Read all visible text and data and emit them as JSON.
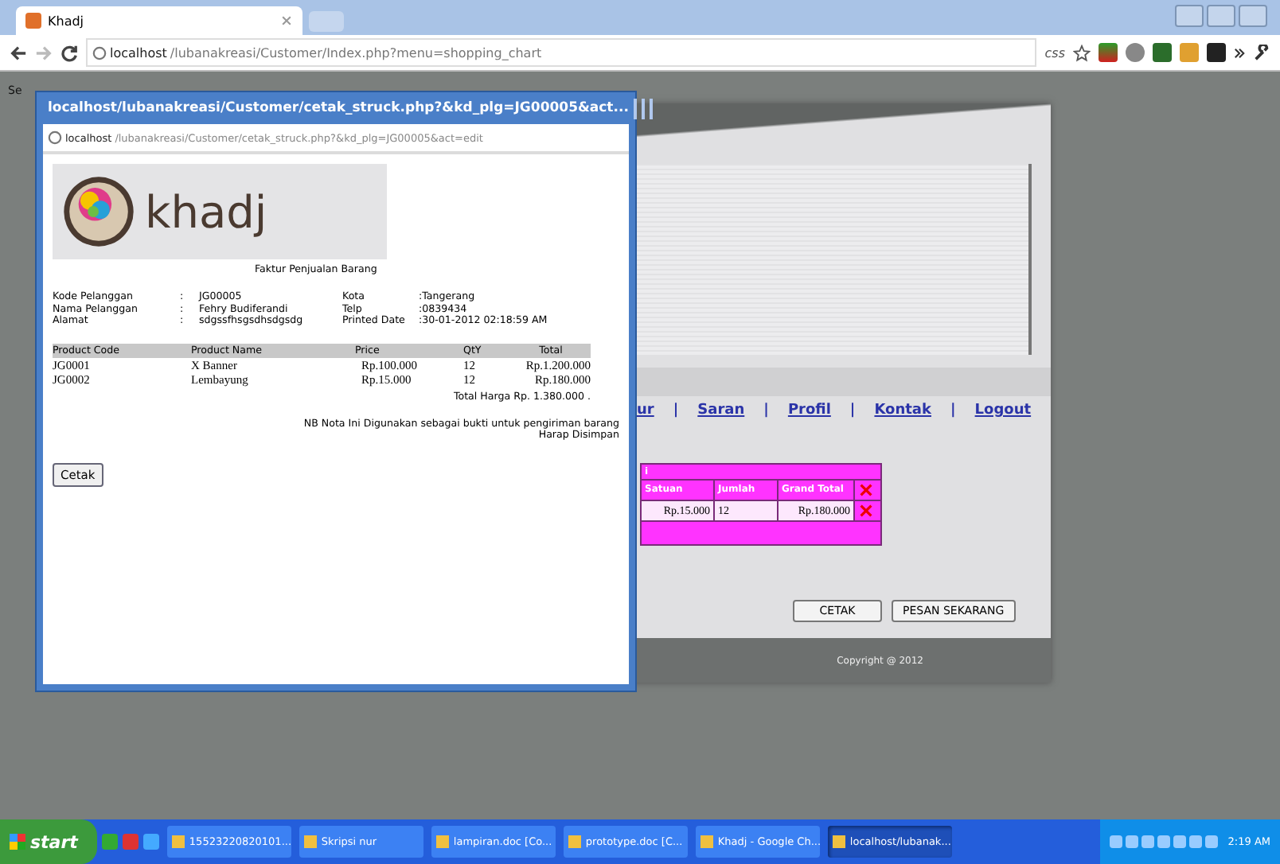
{
  "browser": {
    "tabs": [
      {
        "title": "Khadj",
        "selected": true
      }
    ],
    "url_host": "localhost",
    "url_path": "/lubanakreasi/Customer/Index.php?menu=shopping_chart",
    "css_label": "css"
  },
  "page": {
    "date_text": "Se",
    "separator": "|",
    "nav_links": [
      "ur",
      "Saran",
      "Profil",
      "Kontak",
      "Logout"
    ],
    "cart": {
      "title_fragment": "i",
      "columns": [
        "Satuan",
        "Jumlah",
        "Grand Total"
      ],
      "rows": [
        [
          "Rp.15.000",
          "12",
          "Rp.180.000"
        ]
      ]
    },
    "buttons": [
      "CETAK",
      "PESAN SEKARANG"
    ],
    "footer": "Copyright @ 2012"
  },
  "popup": {
    "title": "localhost/lubanakreasi/Customer/cetak_struck.php?&kd_plg=JG00005&act...",
    "url_host": "localhost",
    "url_path": "/lubanakreasi/Customer/cetak_struck.php?&kd_plg=JG00005&act=edit",
    "logo_text": "khadj",
    "heading": "Faktur Penjualan Barang",
    "info_left": [
      {
        "label": "Kode Pelanggan",
        "sep": ":",
        "value": "JG00005"
      },
      {
        "label": "Nama Pelanggan",
        "sep": ":",
        "value": "Fehry Budiferandi"
      },
      {
        "label": "Alamat",
        "sep": ":",
        "value": "sdgssfhsgsdhsdgsdg"
      }
    ],
    "info_right": [
      {
        "label": "Kota",
        "value": ":Tangerang"
      },
      {
        "label": "Telp",
        "value": ":0839434"
      },
      {
        "label": "Printed Date",
        "value": ":30-01-2012 02:18:59 AM"
      }
    ],
    "columns": [
      "Product Code",
      "Product Name",
      "Price",
      "QtY",
      "Total"
    ],
    "rows": [
      [
        "JG0001",
        "X Banner",
        "Rp.100.000",
        "12",
        "Rp.1.200.000"
      ],
      [
        "JG0002",
        "Lembayung",
        "Rp.15.000",
        "12",
        "Rp.180.000"
      ]
    ],
    "total": "Total Harga  Rp. 1.380.000 .",
    "notes": [
      "NB Nota Ini Digunakan sebagai bukti untuk pengiriman barang",
      "Harap Disimpan"
    ],
    "button": "Cetak"
  },
  "taskbar": {
    "start": "start",
    "items": [
      {
        "label": "15523220820101...",
        "selected": false
      },
      {
        "label": "Skripsi nur",
        "selected": false
      },
      {
        "label": "lampiran.doc [Co...",
        "selected": false
      },
      {
        "label": "prototype.doc [C...",
        "selected": false
      },
      {
        "label": "Khadj - Google Ch...",
        "selected": false
      },
      {
        "label": "localhost/lubanak...",
        "selected": true
      }
    ],
    "clock": "2:19 AM"
  }
}
